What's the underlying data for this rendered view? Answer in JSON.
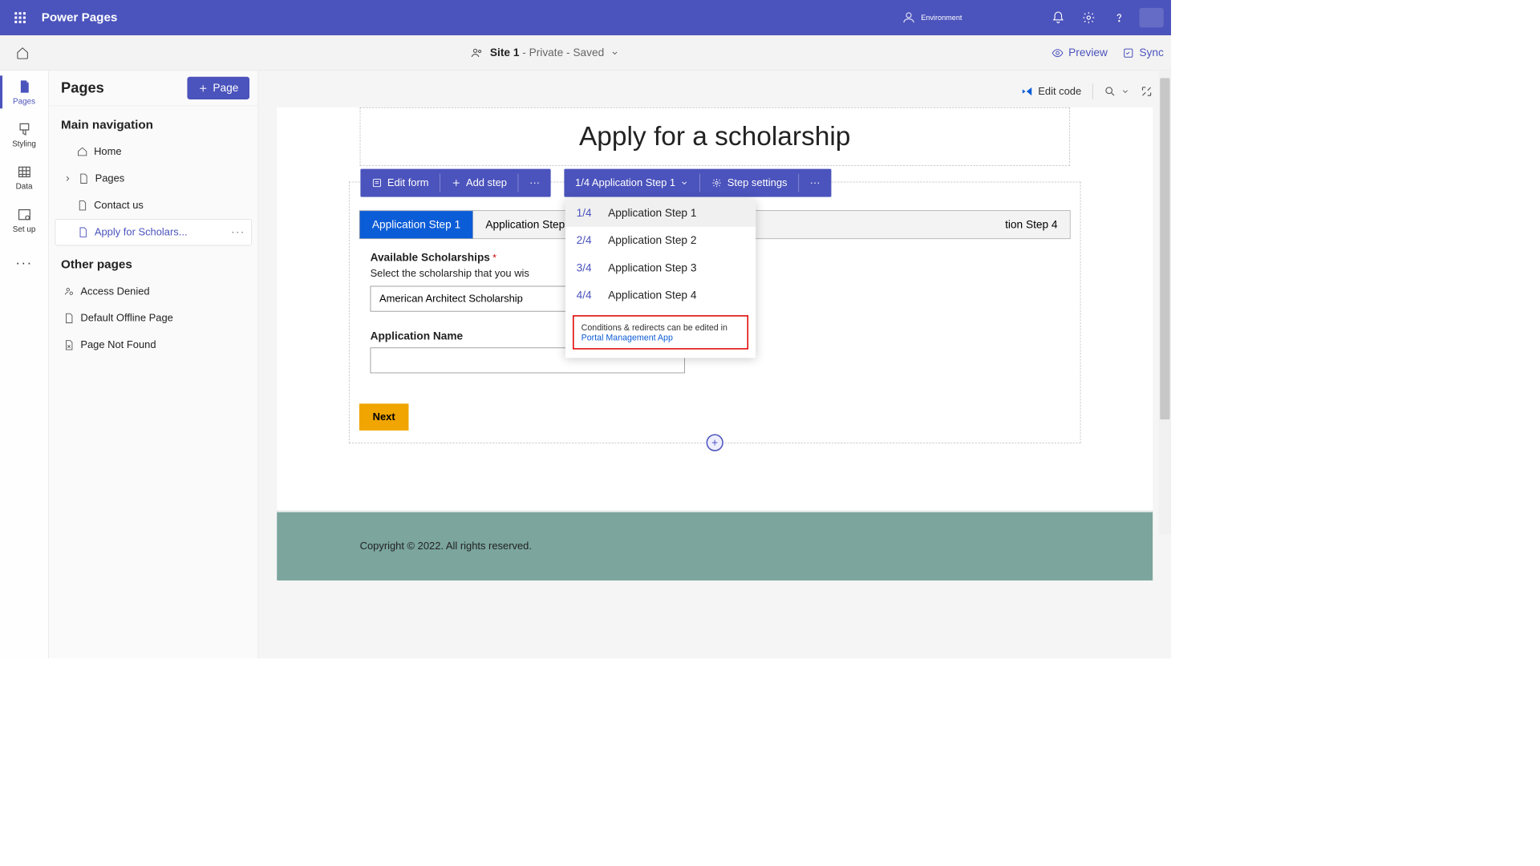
{
  "header": {
    "app_name": "Power Pages",
    "env_label": "Environment"
  },
  "subbar": {
    "site_prefix": "Site 1",
    "site_status": " - Private - Saved",
    "preview": "Preview",
    "sync": "Sync"
  },
  "rail": {
    "pages": "Pages",
    "styling": "Styling",
    "data": "Data",
    "setup": "Set up"
  },
  "pages_panel": {
    "title": "Pages",
    "add_btn": "Page",
    "section_main": "Main navigation",
    "section_other": "Other pages",
    "items_main": [
      {
        "label": "Home",
        "icon": "home"
      },
      {
        "label": "Pages",
        "icon": "page",
        "expandable": true
      },
      {
        "label": "Contact us",
        "icon": "page"
      },
      {
        "label": "Apply for Scholars...",
        "icon": "page",
        "selected": true
      }
    ],
    "items_other": [
      {
        "label": "Access Denied",
        "icon": "person"
      },
      {
        "label": "Default Offline Page",
        "icon": "page"
      },
      {
        "label": "Page Not Found",
        "icon": "page-x"
      }
    ]
  },
  "canvas_toolbar": {
    "edit_code": "Edit code"
  },
  "page": {
    "title": "Apply for a scholarship",
    "footer": "Copyright © 2022. All rights reserved."
  },
  "form_toolbar": {
    "edit_form": "Edit form",
    "add_step": "Add step",
    "step_indicator": "1/4 Application Step 1",
    "step_settings": "Step settings"
  },
  "tabs": [
    "Application Step 1",
    "Application Step 2",
    "Application Step 3",
    "Application Step 4"
  ],
  "tabs_visible": {
    "t0": "Application Step 1",
    "t1": "Application Step",
    "t3_partial": "tion Step 4"
  },
  "form": {
    "avail_label": "Available Scholarships",
    "avail_help": "Select the scholarship that you wis",
    "avail_value": "American Architect Scholarship",
    "app_name_label": "Application Name",
    "next": "Next"
  },
  "popup": {
    "items": [
      {
        "num": "1/4",
        "label": "Application Step 1"
      },
      {
        "num": "2/4",
        "label": "Application Step 2"
      },
      {
        "num": "3/4",
        "label": "Application Step 3"
      },
      {
        "num": "4/4",
        "label": "Application Step 4"
      }
    ],
    "note_text": "Conditions & redirects can be edited in ",
    "note_link": "Portal Management App"
  }
}
